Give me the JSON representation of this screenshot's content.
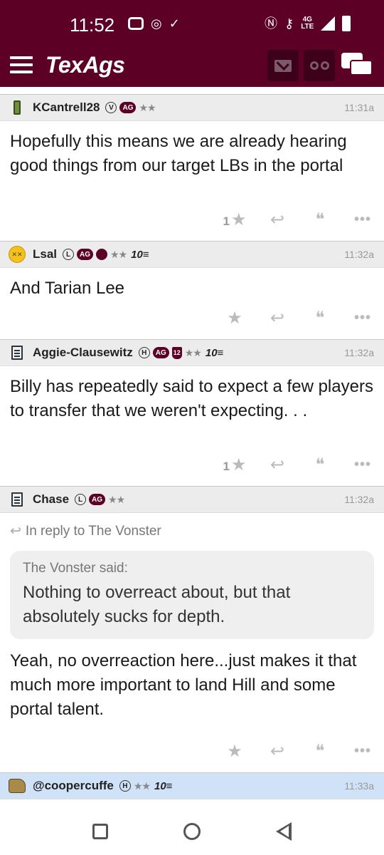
{
  "status_bar": {
    "time": "11:52",
    "network": "4G",
    "network_sub": "LTE"
  },
  "app": {
    "logo": "TexAgs"
  },
  "posts": [
    {
      "username": "KCantrell28",
      "badges": [
        "V",
        "AG"
      ],
      "stars": "★★",
      "time": "11:31a",
      "body": "Hopefully this means we are already hearing good things from our target LBs in the portal",
      "like_count": "1"
    },
    {
      "username": "Lsal",
      "badges": [
        "L",
        "AG"
      ],
      "stars": "★★",
      "tenyear": "10≡",
      "time": "11:32a",
      "body": "And Tarian Lee"
    },
    {
      "username": "Aggie-Clausewitz",
      "badges": [
        "H",
        "AG"
      ],
      "shield": "12",
      "stars": "★★",
      "tenyear": "10≡",
      "time": "11:32a",
      "body": "Billy has repeatedly said to expect a few players to transfer that we weren't expecting. . .",
      "like_count": "1"
    },
    {
      "username": "Chase",
      "badges": [
        "L",
        "AG"
      ],
      "stars": "★★",
      "time": "11:32a",
      "reply_to": "In reply to The Vonster",
      "quote_who": "The Vonster said:",
      "quote_text": "Nothing to overreact about, but that absolutely sucks for depth.",
      "body": "Yeah, no overreaction here...just makes it that much more important to land Hill and some portal talent."
    },
    {
      "username": "@coopercuffe",
      "badges": [
        "H"
      ],
      "stars": "★★",
      "tenyear": "10≡",
      "time": "11:33a"
    }
  ],
  "icons": {
    "star": "★",
    "reply": "↩",
    "quote": "❝",
    "more": "•••"
  }
}
